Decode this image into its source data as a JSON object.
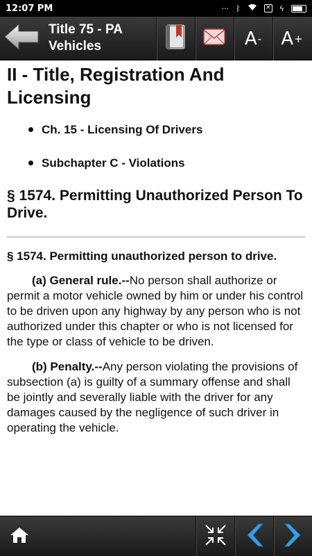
{
  "status": {
    "time": "12:07 PM"
  },
  "toolbar": {
    "title": "Title 75 - PA Vehicles",
    "font_decrease_label": "A",
    "font_decrease_mark": "-",
    "font_increase_label": "A",
    "font_increase_mark": "+"
  },
  "content": {
    "title": "II - Title, Registration And Licensing",
    "crumbs": [
      "Ch. 15 - Licensing Of Drivers",
      "Subchapter C - Violations"
    ],
    "section_title": "§ 1574. Permitting Unauthorized Person To Drive.",
    "section_heading": "§ 1574.  Permitting unauthorized person to drive.",
    "paragraphs": [
      {
        "lead": "(a)  General rule.--",
        "text": "No person shall authorize or permit a motor vehicle owned by him or under his control to be driven upon any highway by any person who is not authorized under this chapter or who is not licensed for the type or class of vehicle to be driven."
      },
      {
        "lead": "(b)  Penalty.--",
        "text": "Any person violating the provisions of subsection (a) is guilty of a summary offense and shall be jointly and severally liable with the driver for any damages caused by the negligence of such driver in operating the vehicle."
      }
    ]
  },
  "icons": {
    "back": "back-arrow-icon",
    "bookmark": "bookmark-book-icon",
    "email": "email-envelope-icon",
    "home": "home-icon",
    "collapse": "collapse-arrows-icon",
    "previous": "chevron-left-icon",
    "next": "chevron-right-icon"
  },
  "colors": {
    "toolbar": "#2a2a2a",
    "accent_blue": "#3aa0e6",
    "bookmark_red": "#c0392b"
  }
}
